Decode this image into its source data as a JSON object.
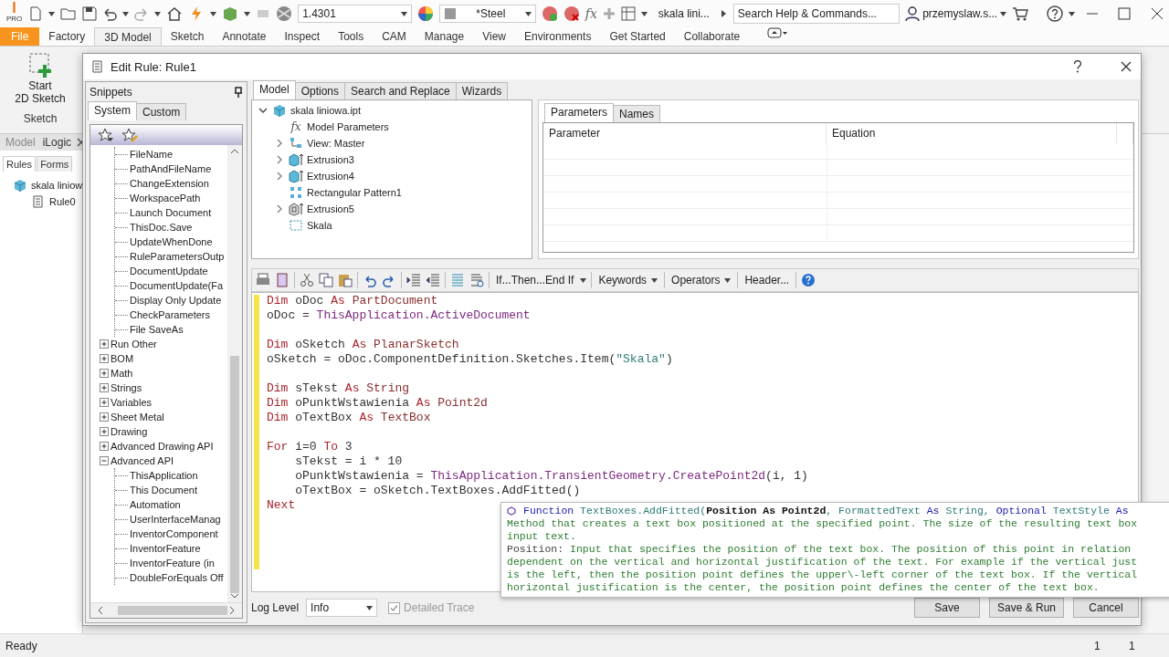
{
  "app_bar": {
    "logo": {
      "letter": "I",
      "edition": "PRO"
    },
    "material_value": "1.4301",
    "appearance": "*Steel",
    "formula_glyph": "fx",
    "document": "skala lini...",
    "search": {
      "placeholder": "Search Help & Commands..."
    },
    "user": "przemyslaw.s..."
  },
  "ribbon": {
    "tabs": [
      {
        "label": "File",
        "kind": "file",
        "selected": false
      },
      {
        "label": "Factory",
        "kind": "tab",
        "selected": false
      },
      {
        "label": "3D Model",
        "kind": "tab",
        "selected": true
      },
      {
        "label": "Sketch",
        "kind": "tab",
        "selected": false
      },
      {
        "label": "Annotate",
        "kind": "tab",
        "selected": false
      },
      {
        "label": "Inspect",
        "kind": "tab",
        "selected": false
      },
      {
        "label": "Tools",
        "kind": "tab",
        "selected": false
      },
      {
        "label": "CAM",
        "kind": "tab",
        "selected": false
      },
      {
        "label": "Manage",
        "kind": "tab",
        "selected": false
      },
      {
        "label": "View",
        "kind": "tab",
        "selected": false
      },
      {
        "label": "Environments",
        "kind": "tab",
        "selected": false
      },
      {
        "label": "Get Started",
        "kind": "tab",
        "selected": false
      },
      {
        "label": "Collaborate",
        "kind": "tab",
        "selected": false
      }
    ],
    "start_sketch": [
      "Start",
      "2D Sketch"
    ],
    "panel_label": "Sketch"
  },
  "browser": {
    "tabs": [
      {
        "label": "Model",
        "selected": false
      },
      {
        "label": "iLogic",
        "selected": true
      }
    ],
    "subtabs": [
      {
        "label": "Rules",
        "selected": true
      },
      {
        "label": "Forms",
        "selected": false
      }
    ],
    "tree": [
      {
        "label": "skala liniow",
        "children": [
          {
            "label": "Rule0"
          }
        ]
      }
    ]
  },
  "dialog": {
    "title": "Edit Rule: Rule1",
    "snippets": {
      "title": "Snippets",
      "tabs": [
        {
          "label": "System",
          "selected": true
        },
        {
          "label": "Custom",
          "selected": false
        }
      ],
      "continued": [
        "FileName",
        "PathAndFileName",
        "ChangeExtension",
        "WorkspacePath",
        "Launch Document",
        "ThisDoc.Save",
        "UpdateWhenDone",
        "RuleParametersOutp",
        "DocumentUpdate",
        "DocumentUpdate(Fa",
        "Display Only Update",
        "CheckParameters",
        "File SaveAs"
      ],
      "groups": [
        {
          "label": "Run Other",
          "expanded": false
        },
        {
          "label": "BOM",
          "expanded": false
        },
        {
          "label": "Math",
          "expanded": false
        },
        {
          "label": "Strings",
          "expanded": false
        },
        {
          "label": "Variables",
          "expanded": false
        },
        {
          "label": "Sheet Metal",
          "expanded": false
        },
        {
          "label": "Drawing",
          "expanded": false
        },
        {
          "label": "Advanced Drawing API",
          "expanded": false
        },
        {
          "label": "Advanced API",
          "expanded": true,
          "children": [
            "ThisApplication",
            "This Document",
            "Automation",
            "UserInterfaceManag",
            "InventorComponent",
            "InventorFeature",
            "InventorFeature (in",
            "DoubleForEquals Off"
          ]
        }
      ]
    },
    "tabs": [
      {
        "label": "Model",
        "selected": true
      },
      {
        "label": "Options",
        "selected": false
      },
      {
        "label": "Search and Replace",
        "selected": false
      },
      {
        "label": "Wizards",
        "selected": false
      }
    ],
    "model_tree": {
      "label": "skala liniowa.ipt",
      "expanded": true,
      "children": [
        {
          "label": "Model Parameters",
          "kind": "parameters",
          "glyph": "fx"
        },
        {
          "label": "View: Master",
          "kind": "view",
          "expanded": false
        },
        {
          "label": "Extrusion3",
          "kind": "extrusion",
          "expanded": false
        },
        {
          "label": "Extrusion4",
          "kind": "extrusion",
          "expanded": false
        },
        {
          "label": "Rectangular Pattern1",
          "kind": "pattern"
        },
        {
          "label": "Extrusion5",
          "kind": "frame",
          "expanded": false
        },
        {
          "label": "Skala",
          "kind": "sketch"
        }
      ]
    },
    "parameters": {
      "tabs": [
        {
          "label": "Parameters",
          "selected": true
        },
        {
          "label": "Names",
          "selected": false
        }
      ],
      "columns": [
        "Parameter",
        "Equation"
      ]
    },
    "toolbar": [
      {
        "label": "If...Then...End If",
        "kind": "split"
      },
      {
        "label": "Keywords",
        "kind": "menu"
      },
      {
        "label": "Operators",
        "kind": "menu"
      },
      {
        "label": "Header...",
        "kind": "button"
      }
    ],
    "code": [
      {
        "kind": "code",
        "tokens": [
          {
            "kind": "keyword",
            "text": "Dim"
          },
          {
            "kind": "plain",
            "text": " oDoc "
          },
          {
            "kind": "keyword",
            "text": "As"
          },
          {
            "kind": "type",
            "text": " PartDocument"
          }
        ]
      },
      {
        "kind": "code",
        "tokens": [
          {
            "kind": "plain",
            "text": "oDoc = "
          },
          {
            "kind": "object",
            "text": "ThisApplication.ActiveDocument"
          }
        ]
      },
      {
        "kind": "blank"
      },
      {
        "kind": "code",
        "tokens": [
          {
            "kind": "keyword",
            "text": "Dim"
          },
          {
            "kind": "plain",
            "text": " oSketch "
          },
          {
            "kind": "keyword",
            "text": "As"
          },
          {
            "kind": "type",
            "text": " PlanarSketch"
          }
        ]
      },
      {
        "kind": "code",
        "tokens": [
          {
            "kind": "plain",
            "text": "oSketch = oDoc.ComponentDefinition.Sketches.Item("
          },
          {
            "kind": "string",
            "text": "\"Skala\""
          },
          {
            "kind": "plain",
            "text": ")"
          }
        ]
      },
      {
        "kind": "blank"
      },
      {
        "kind": "code",
        "tokens": [
          {
            "kind": "keyword",
            "text": "Dim"
          },
          {
            "kind": "plain",
            "text": " sTekst "
          },
          {
            "kind": "keyword",
            "text": "As"
          },
          {
            "kind": "type",
            "text": " String"
          }
        ]
      },
      {
        "kind": "code",
        "tokens": [
          {
            "kind": "keyword",
            "text": "Dim"
          },
          {
            "kind": "plain",
            "text": " oPunktWstawienia "
          },
          {
            "kind": "keyword",
            "text": "As"
          },
          {
            "kind": "type",
            "text": " Point2d"
          }
        ]
      },
      {
        "kind": "code",
        "tokens": [
          {
            "kind": "keyword",
            "text": "Dim"
          },
          {
            "kind": "plain",
            "text": " oTextBox "
          },
          {
            "kind": "keyword",
            "text": "As"
          },
          {
            "kind": "type",
            "text": " TextBox"
          }
        ]
      },
      {
        "kind": "blank"
      },
      {
        "kind": "code",
        "tokens": [
          {
            "kind": "keyword",
            "text": "For"
          },
          {
            "kind": "plain",
            "text": " i=0 "
          },
          {
            "kind": "keyword",
            "text": "To"
          },
          {
            "kind": "plain",
            "text": " 3"
          }
        ]
      },
      {
        "kind": "code",
        "tokens": [
          {
            "kind": "plain",
            "text": "    sTekst = i * 10"
          }
        ]
      },
      {
        "kind": "code",
        "tokens": [
          {
            "kind": "plain",
            "text": "    oPunktWstawienia = "
          },
          {
            "kind": "object",
            "text": "ThisApplication.TransientGeometry.CreatePoint2d"
          },
          {
            "kind": "plain",
            "text": "(i, 1)"
          }
        ]
      },
      {
        "kind": "code",
        "tokens": [
          {
            "kind": "plain",
            "text": "    oTextBox = oSketch.TextBoxes.AddFitted()"
          }
        ]
      },
      {
        "kind": "code",
        "tokens": [
          {
            "kind": "keyword",
            "text": "Next"
          }
        ]
      }
    ],
    "tooltip": {
      "signature": [
        {
          "kind": "keyword",
          "text": "Function"
        },
        {
          "kind": "name",
          "text": " TextBoxes.AddFitted("
        },
        {
          "kind": "current",
          "text": "Position As Point2d"
        },
        {
          "kind": "name",
          "text": ", FormattedText"
        },
        {
          "kind": "keyword",
          "text": " As"
        },
        {
          "kind": "name",
          "text": " String, "
        },
        {
          "kind": "keyword",
          "text": "Optional"
        },
        {
          "kind": "name",
          "text": " TextStyle"
        },
        {
          "kind": "keyword",
          "text": " As"
        }
      ],
      "lines": [
        {
          "kind": "text",
          "text": "Method that creates a text box positioned at the specified point. The size of the resulting text box"
        },
        {
          "kind": "text",
          "text": "input text."
        },
        {
          "kind": "param",
          "label": "Position:",
          "text": " Input that specifies the position of the text box. The position of this point in relation"
        },
        {
          "kind": "text",
          "text": "dependent on the vertical and horizontal justification of the text. For example if the vertical just"
        },
        {
          "kind": "text",
          "text": "is the left, then the position point defines the upper\\-left corner of the text box. If the vertical"
        },
        {
          "kind": "text",
          "text": "horizontal justification is the center, the position point defines the center of the text box."
        }
      ]
    },
    "footer": {
      "log_level_label": "Log Level",
      "log_level": "Info",
      "detailed_trace": {
        "label": "Detailed Trace",
        "checked": true,
        "disabled": true
      },
      "buttons": [
        "Save",
        "Save & Run",
        "Cancel"
      ]
    }
  },
  "status_bar": {
    "message": "Ready",
    "fields": [
      "1",
      "1"
    ]
  }
}
